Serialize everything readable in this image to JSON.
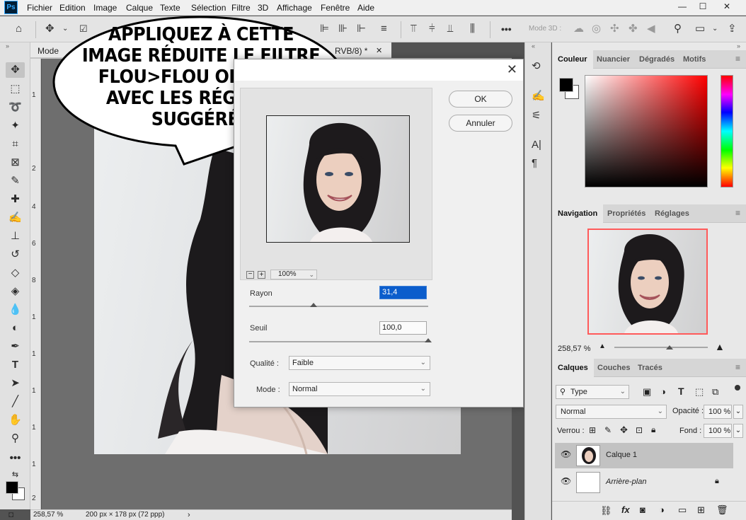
{
  "app": {
    "logo_label": "Ps"
  },
  "menubar": {
    "items": [
      "Fichier",
      "Edition",
      "Image",
      "Calque",
      "Texte",
      "Sélection",
      "Filtre",
      "3D",
      "Affichage",
      "Fenêtre",
      "Aide"
    ]
  },
  "options_bar": {
    "mode3d_label": "Mode 3D :"
  },
  "document": {
    "tab_name": "Mode",
    "tab_suffix": "RVB/8) *",
    "zoom": "258,57 %",
    "doc_info": "200 px × 178 px (72 ppp)"
  },
  "rulers": {
    "left_numbers": [
      "1",
      "2",
      "4",
      "6",
      "8",
      "1",
      "1",
      "1",
      "1",
      "1",
      "2"
    ]
  },
  "tooltip_bubble": {
    "lines": [
      "Appliquez à cette",
      "image réduite le filtre",
      "Flou>Flou optimisé",
      "avec les réglages",
      "suggérés"
    ]
  },
  "dialog": {
    "ok_label": "OK",
    "cancel_label": "Annuler",
    "preview_zoom": "100%",
    "radius_label": "Rayon",
    "radius_value": "31,4",
    "radius_level": 0.36,
    "threshold_label": "Seuil",
    "threshold_value": "100,0",
    "threshold_level": 1.0,
    "quality_label": "Qualité :",
    "quality_value": "Faible",
    "mode_label": "Mode :",
    "mode_value": "Normal"
  },
  "color_panel": {
    "tabs": [
      "Couleur",
      "Nuancier",
      "Dégradés",
      "Motifs"
    ],
    "fg_color": "#000000",
    "bg_color": "#ffffff"
  },
  "nav_panel": {
    "tabs": [
      "Navigation",
      "Propriétés",
      "Réglages"
    ],
    "zoom": "258,57 %"
  },
  "layers_panel": {
    "tabs": [
      "Calques",
      "Couches",
      "Tracés"
    ],
    "filter_kind": "Type",
    "blend_mode": "Normal",
    "opacity_label": "Opacité :",
    "opacity_value": "100 %",
    "lock_label": "Verrou :",
    "fill_label": "Fond :",
    "fill_value": "100 %",
    "layers": [
      {
        "name": "Calque 1",
        "selected": true
      },
      {
        "name": "Arrière-plan",
        "selected": false,
        "italic": true
      }
    ]
  }
}
